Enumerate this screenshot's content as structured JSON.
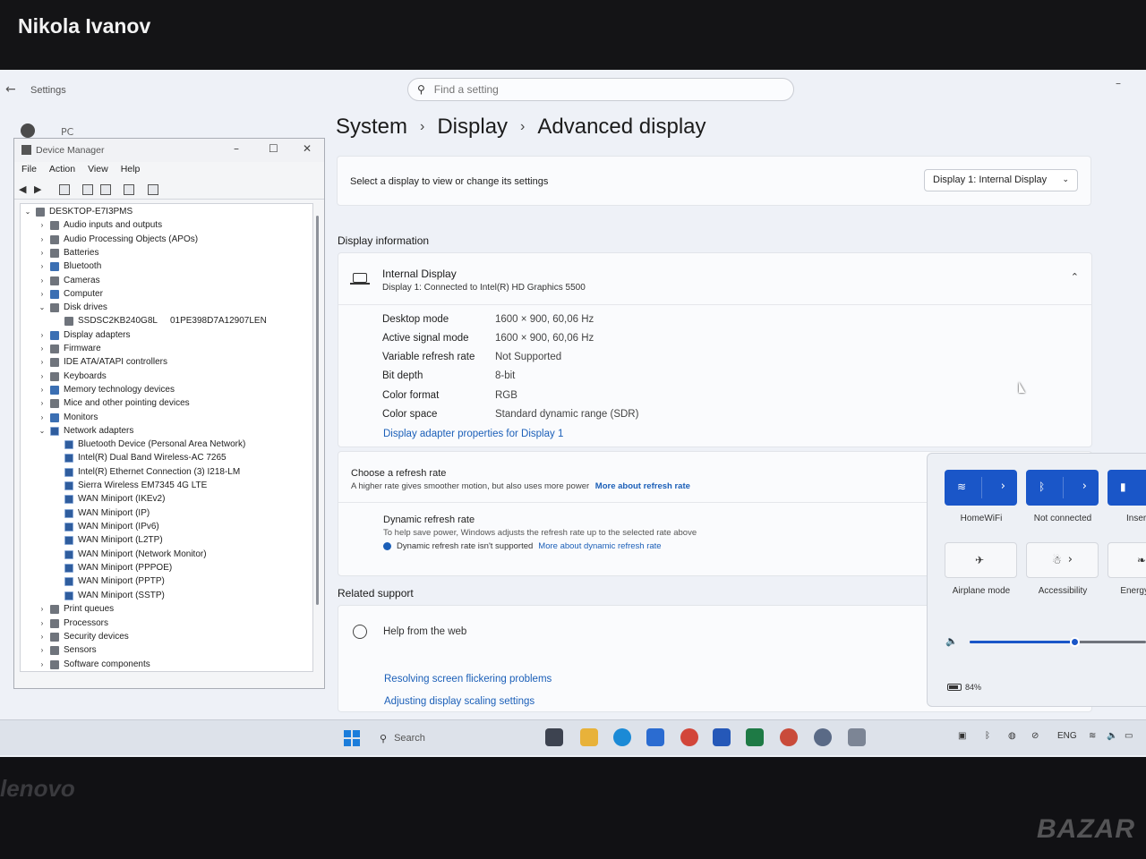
{
  "photo": {
    "owner_name": "Nikola Ivanov",
    "bezel_brand": "lenovo",
    "watermark": "BAZAR"
  },
  "settings": {
    "window_title": "Settings",
    "search_placeholder": "Find a setting",
    "account_label": "PC",
    "breadcrumb": [
      "System",
      "Display",
      "Advanced display"
    ],
    "select_prompt": "Select a display to view or change its settings",
    "display_dropdown": "Display 1: Internal Display",
    "display_info_heading": "Display information",
    "display_name": "Internal Display",
    "display_connection": "Display 1: Connected to Intel(R) HD Graphics 5500",
    "properties": [
      {
        "key": "Desktop mode",
        "value": "1600 × 900, 60,06 Hz"
      },
      {
        "key": "Active signal mode",
        "value": "1600 × 900, 60,06 Hz"
      },
      {
        "key": "Variable refresh rate",
        "value": "Not Supported"
      },
      {
        "key": "Bit depth",
        "value": "8-bit"
      },
      {
        "key": "Color format",
        "value": "RGB"
      },
      {
        "key": "Color space",
        "value": "Standard dynamic range (SDR)"
      }
    ],
    "adapter_link": "Display adapter properties for Display 1",
    "refresh_title": "Choose a refresh rate",
    "refresh_sub": "A higher rate gives smoother motion, but also uses more power",
    "refresh_link": "More about refresh rate",
    "dynamic_title": "Dynamic refresh rate",
    "dynamic_sub": "To help save power, Windows adjusts the refresh rate up to the selected rate above",
    "dynamic_note": "Dynamic refresh rate isn't supported",
    "dynamic_link": "More about dynamic refresh rate",
    "related_heading": "Related support",
    "help_title": "Help from the web",
    "help_links": [
      "Resolving screen flickering problems",
      "Adjusting display scaling settings"
    ]
  },
  "device_manager": {
    "title": "Device Manager",
    "menu": [
      "File",
      "Action",
      "View",
      "Help"
    ],
    "root": "DESKTOP-E7I3PMS",
    "categories": [
      "Audio inputs and outputs",
      "Audio Processing Objects (APOs)",
      "Batteries",
      "Bluetooth",
      "Cameras",
      "Computer",
      "Disk drives"
    ],
    "disk": {
      "model": "SSDSC2KB240G8L",
      "serial": "01PE398D7A12907LEN"
    },
    "categories_mid": [
      "Display adapters",
      "Firmware",
      "IDE ATA/ATAPI controllers",
      "Keyboards",
      "Memory technology devices",
      "Mice and other pointing devices",
      "Monitors",
      "Network adapters"
    ],
    "network_adapters": [
      "Bluetooth Device (Personal Area Network)",
      "Intel(R) Dual Band Wireless-AC 7265",
      "Intel(R) Ethernet Connection (3) I218-LM",
      "Sierra Wireless EM7345 4G LTE",
      "WAN Miniport (IKEv2)",
      "WAN Miniport (IP)",
      "WAN Miniport (IPv6)",
      "WAN Miniport (L2TP)",
      "WAN Miniport (Network Monitor)",
      "WAN Miniport (PPPOE)",
      "WAN Miniport (PPTP)",
      "WAN Miniport (SSTP)"
    ],
    "categories_end": [
      "Print queues",
      "Processors",
      "Security devices",
      "Sensors",
      "Software components"
    ]
  },
  "quick_settings": {
    "tiles": [
      "HomeWiFi",
      "Not connected",
      "Insert",
      "Airplane mode",
      "Accessibility",
      "Energy"
    ],
    "volume_level": 0.6,
    "battery_text": "84%"
  },
  "taskbar": {
    "search_placeholder": "Search",
    "language": "ENG"
  },
  "colors": {
    "accent": "#1a56c8",
    "link": "#1b5fb8",
    "start": "#1b7ddb"
  }
}
